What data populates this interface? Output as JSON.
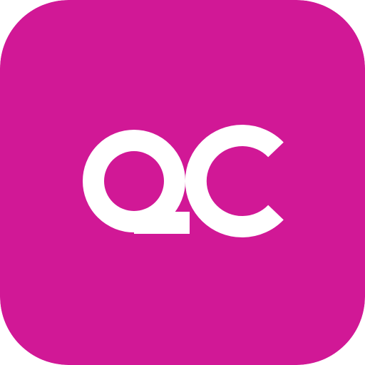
{
  "icon": {
    "monogram": "QC",
    "background_color": "#D11896",
    "foreground_color": "#FFFFFF",
    "icon_name": "qc-monogram-app-icon"
  }
}
